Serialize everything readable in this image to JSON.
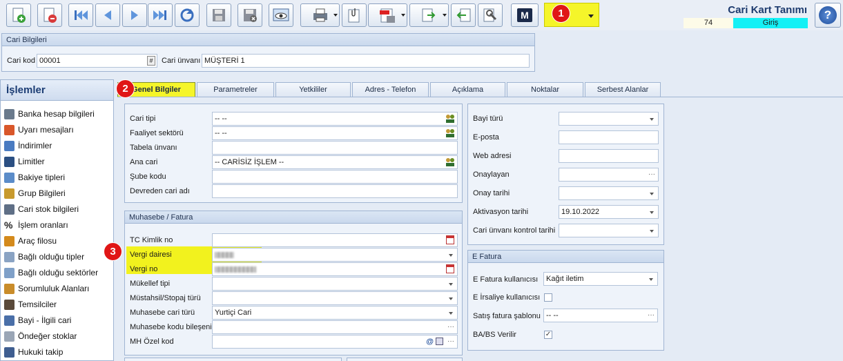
{
  "toolbar": {
    "buttons": [
      "new-record-icon",
      "delete-record-icon",
      "first-record-icon",
      "prev-record-icon",
      "next-record-icon",
      "last-record-icon",
      "refresh-icon",
      "save-icon",
      "cancel-save-icon",
      "preview-icon",
      "print-icon",
      "attach-icon",
      "pdf-icon",
      "export-icon",
      "import-icon",
      "tools-icon"
    ],
    "m_label": "M"
  },
  "annotations": [
    "1",
    "2",
    "3"
  ],
  "header": {
    "title": "Cari Kart Tanımı",
    "record_no": "74",
    "mode": "Giriş"
  },
  "cari_bilgileri": {
    "title": "Cari Bilgileri",
    "kod_label": "Cari kod",
    "kod_value": "00001",
    "kod_btn": "#",
    "unvan_label": "Cari ünvanı",
    "unvan_value": "MÜŞTERİ 1"
  },
  "sidebar": {
    "title": "İşlemler",
    "items": [
      "Banka hesap bilgileri",
      "Uyarı mesajları",
      "İndirimler",
      "Limitler",
      "Bakiye tipleri",
      "Grup Bilgileri",
      "Cari stok bilgileri",
      "İşlem oranları",
      "Araç filosu",
      "Bağlı olduğu tipler",
      "Bağlı olduğu sektörler",
      "Sorumluluk Alanları",
      "Temsilciler",
      "Bayi - İlgili cari",
      "Öndeğer stoklar",
      "Hukuki takip"
    ]
  },
  "tabs": [
    "Genel Bilgiler",
    "Parametreler",
    "Yetkililer",
    "Adres - Telefon",
    "Açıklama",
    "Noktalar",
    "Serbest Alanlar"
  ],
  "genel": {
    "cari_tipi_label": "Cari tipi",
    "cari_tipi_value": "-- --",
    "faaliyet_label": "Faaliyet sektörü",
    "faaliyet_value": "-- --",
    "tabela_label": "Tabela ünvanı",
    "ana_cari_label": "Ana cari",
    "ana_cari_value": "-- CARİSİZ İŞLEM --",
    "sube_label": "Şube kodu",
    "devreden_label": "Devreden cari adı"
  },
  "muhasebe": {
    "title": "Muhasebe / Fatura",
    "tc_label": "TC Kimlik no",
    "vergi_dairesi_label": "Vergi dairesi",
    "vergi_no_label": "Vergi no",
    "mukellef_label": "Mükellef tipi",
    "mustahsil_label": "Müstahsil/Stopaj türü",
    "muh_cari_turu_label": "Muhasebe cari türü",
    "muh_cari_turu_value": "Yurtiçi Cari",
    "muh_kodu_label": "Muhasebe kodu bileşeni",
    "mh_ozel_label": "MH Özel kod"
  },
  "right": {
    "bayi_turu_label": "Bayi türü",
    "eposta_label": "E-posta",
    "web_label": "Web adresi",
    "onaylayan_label": "Onaylayan",
    "onay_tarihi_label": "Onay tarihi",
    "aktivasyon_label": "Aktivasyon tarihi",
    "aktivasyon_value": "19.10.2022",
    "kontrol_label": "Cari ünvanı kontrol tarihi"
  },
  "efatura": {
    "title": "E Fatura",
    "kullanici_label": "E Fatura kullanıcısı",
    "kullanici_value": "Kağıt iletim",
    "irsaliye_label": "E İrsaliye kullanıcısı",
    "sablon_label": "Satış fatura şablonu",
    "sablon_value": "-- --",
    "babs_label": "BA/BS Verilir",
    "babs_checked": true
  },
  "colors": {
    "highlight": "#f5f52a",
    "mode_bg": "#14f0f5",
    "badge": "#e01616",
    "accent": "#1c3d74"
  }
}
